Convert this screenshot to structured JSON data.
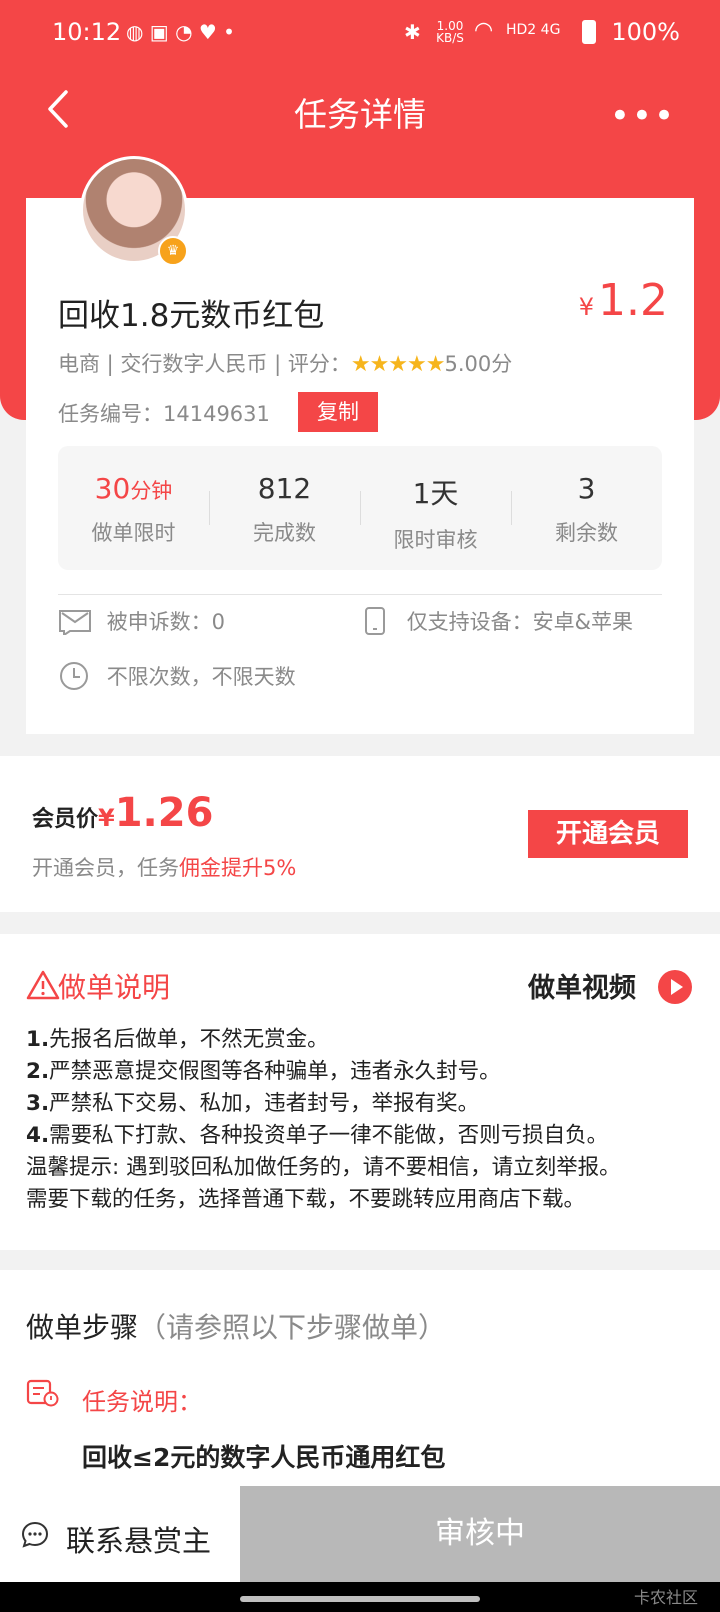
{
  "status": {
    "time": "10:12",
    "speed": "1.00 KB/S",
    "signal": "HD2 4G",
    "battery": "100%"
  },
  "header": {
    "title": "任务详情",
    "more": "•••"
  },
  "task": {
    "title": "回收1.8元数币红包",
    "price_symbol": "¥",
    "price": "1.2",
    "meta_prefix": "电商 | 交行数字人民币 | 评分：",
    "stars": "★★★★★",
    "rating": "5.00分",
    "task_no": "任务编号：14149631",
    "copy_label": "复制"
  },
  "stats": [
    {
      "value": "30",
      "unit": "分钟",
      "label": "做单限时"
    },
    {
      "value": "812",
      "unit": "",
      "label": "完成数"
    },
    {
      "value": "1天",
      "unit": "",
      "label": "限时审核"
    },
    {
      "value": "3",
      "unit": "",
      "label": "剩余数"
    }
  ],
  "info": {
    "complaints": "被申诉数：0",
    "devices": "仅支持设备：安卓&苹果",
    "limits": "不限次数，不限天数"
  },
  "member": {
    "label": "会员价",
    "symbol": "¥",
    "price": "1.26",
    "sub_prefix": "开通会员，任务",
    "sub_highlight": "佣金提升5%",
    "button": "开通会员"
  },
  "instructions": {
    "title": "做单说明",
    "video": "做单视频",
    "lines": [
      {
        "num": "1.",
        "text": "先报名后做单，不然无赏金。"
      },
      {
        "num": "2.",
        "text": "严禁恶意提交假图等各种骗单，违者永久封号。"
      },
      {
        "num": "3.",
        "text": "严禁私下交易、私加，违者封号，举报有奖。"
      },
      {
        "num": "4.",
        "text": "需要私下打款、各种投资单子一律不能做，否则亏损自负。"
      },
      {
        "num": "",
        "text": "温馨提示: 遇到驳回私加做任务的，请不要相信，请立刻举报。"
      },
      {
        "num": "",
        "text": "需要下载的任务，选择普通下载，不要跳转应用商店下载。"
      }
    ]
  },
  "steps": {
    "title": "做单步骤",
    "note": "（请参照以下步骤做单）",
    "desc_label": "任务说明：",
    "desc_text": "回收≤2元的数字人民币通用红包"
  },
  "bottom": {
    "contact": "联系悬赏主",
    "status_button": "审核中"
  },
  "watermark": "卡农社区",
  "colors": {
    "accent": "#f44647",
    "star": "#f6b51d",
    "disabled": "#b8b8b8"
  }
}
